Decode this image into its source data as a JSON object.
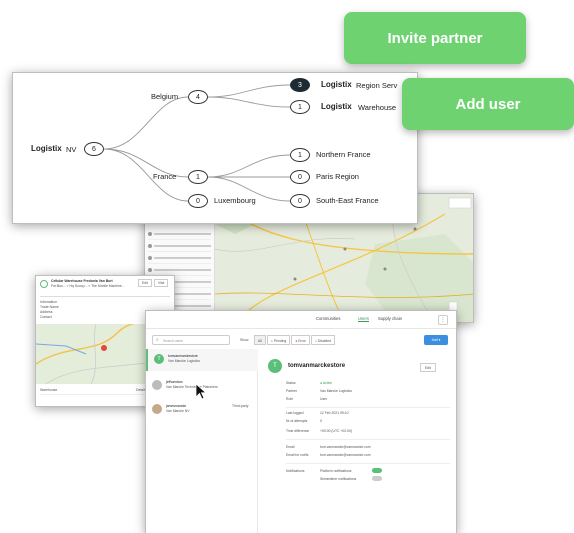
{
  "buttons": {
    "invite_partner": "Invite partner",
    "add_user": "Add user"
  },
  "tree": {
    "root": {
      "brand": "Logistix",
      "name": "NV",
      "count": "6"
    },
    "belgium": {
      "label": "Belgium",
      "count": "4"
    },
    "france": {
      "label": "France",
      "count": "1"
    },
    "luxembourg": {
      "label": "Luxembourg",
      "count": "0"
    },
    "region_serv": {
      "brand": "Logistix",
      "label": "Region Serv",
      "count": "3"
    },
    "warehouse": {
      "brand": "Logistix",
      "label": "Warehouse",
      "count": "1"
    },
    "northern_france": {
      "label": "Northern France",
      "count": "1"
    },
    "paris_region": {
      "label": "Paris Region",
      "count": "0"
    },
    "southeast_france": {
      "label": "South-East France",
      "count": "0"
    }
  },
  "detail_card": {
    "title": "Cellular Warehouse Fredonia Van Burt",
    "subtitle": "Fre:Bus... > Hq Scoop... > The Mobile Machine...",
    "btn1": "Edit",
    "btn2": "Visit",
    "lines": [
      "Information",
      "Trade Name",
      "Address",
      "Contact"
    ],
    "footer_left": "Warehouse",
    "footer_right": "Details"
  },
  "users_panel": {
    "tabs": [
      "Communities",
      "Users",
      "Supply chain"
    ],
    "active_tab": "Users",
    "add_label": "Add",
    "search_placeholder": "Search users",
    "show_label": "Show",
    "filters": [
      "All",
      "Pending",
      "Error",
      "Disabled"
    ],
    "filter_colors": [
      "#ffffff",
      "#f0a030",
      "#e04a3a",
      "#bbbbbb"
    ],
    "users": [
      {
        "name": "tomvanmarckestore",
        "company": "Van Marcke Logistics",
        "status": "",
        "selected": true
      },
      {
        "name": "jeffvandam",
        "company": "Van Marcke Technische Platoniers",
        "status": "",
        "selected": false
      },
      {
        "name": "jamesmarcke",
        "company": "Van Marcke NV",
        "status": "Third-party",
        "selected": false
      }
    ],
    "profile": {
      "avatar_letter": "T",
      "name": "tomvanmarckestore",
      "edit_label": "Edit",
      "fields": [
        {
          "label": "Status",
          "value": "Active"
        },
        {
          "label": "Partner",
          "value": "Van Marcke Logistics"
        },
        {
          "label": "Role",
          "value": "User"
        },
        {
          "label": "Last logged",
          "value": "12 Feb 2021 09:10"
        },
        {
          "label": "Nr of attempts",
          "value": "0"
        },
        {
          "label": "Time difference",
          "value": "+00:00 (UTC +02:00)"
        },
        {
          "label": "Email",
          "value": "tom.vanmarcke@vanmarcke.com"
        },
        {
          "label": "Email for notifs",
          "value": "tom.vanmarcke@vanmarcke.com"
        }
      ],
      "notif_label": "Notifications",
      "notif_platform": "Platform notifications",
      "notif_stream": "Streamliner notifications"
    }
  }
}
